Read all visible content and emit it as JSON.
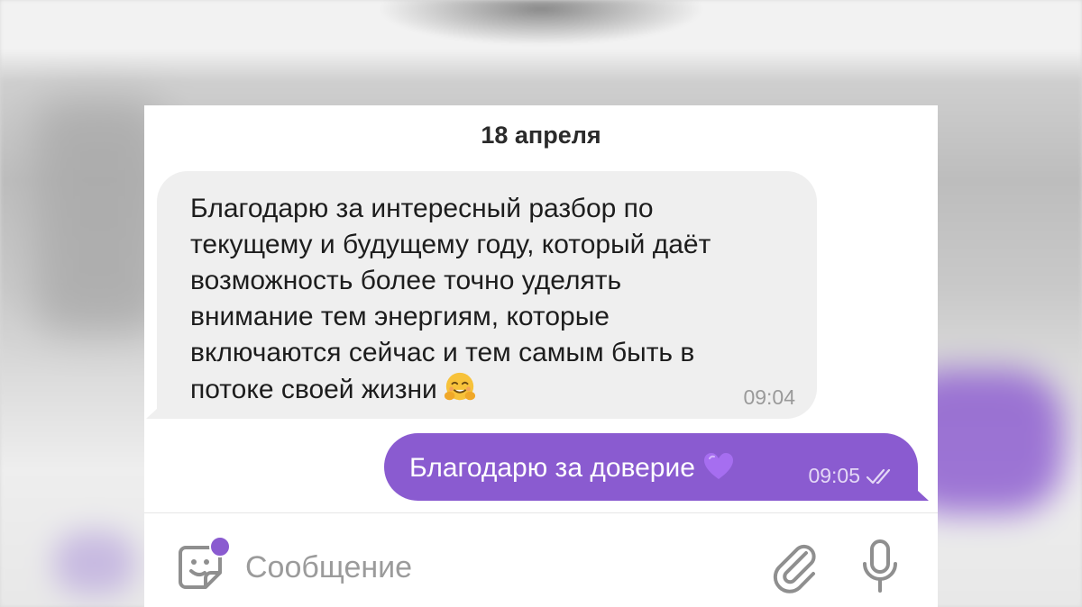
{
  "chat": {
    "date": "18 апреля",
    "incoming": {
      "text": "Благодарю за интересный разбор по\nтекущему и будущему году, который даёт\nвозможность более точно уделять\nвнимание тем энергиям, которые\nвключаются сейчас и тем самым быть в\nпотоке своей жизни",
      "emoji": "hugging-face-emoji",
      "time": "09:04"
    },
    "outgoing": {
      "text": "Благодарю за доверие",
      "emoji": "purple-heart-emoji",
      "time": "09:05",
      "status": "read",
      "status_icon": "double-check-icon"
    }
  },
  "composer": {
    "placeholder": "Сообщение",
    "value": "",
    "sticker_icon": "sticker-icon",
    "attach_icon": "paperclip-icon",
    "mic_icon": "microphone-icon"
  },
  "colors": {
    "accent": "#8a5bd0",
    "incoming_bubble": "#efefef",
    "background": "#ffffff",
    "muted_text": "#9b9b9b"
  }
}
